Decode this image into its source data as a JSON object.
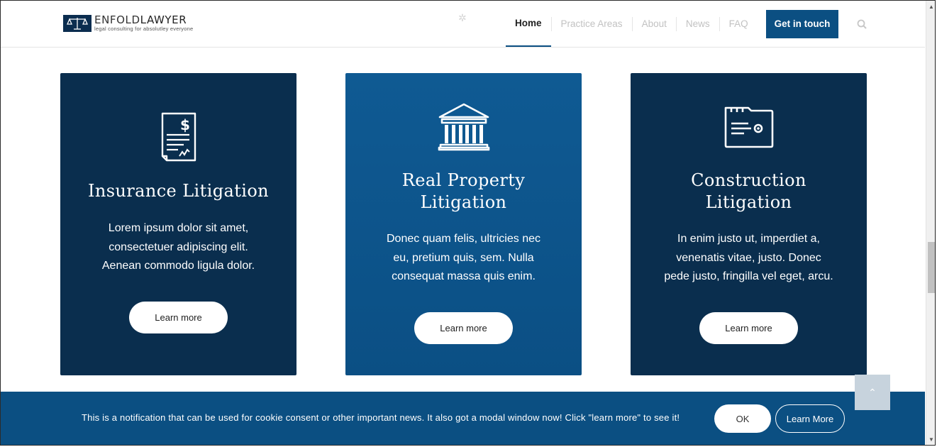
{
  "header": {
    "logo": {
      "name_part1": "ENFOLD",
      "name_part2": "LAWYER",
      "tagline": "legal consulting for absolutley everyone"
    },
    "nav": [
      {
        "label": "Home",
        "active": true
      },
      {
        "label": "Practice Areas"
      },
      {
        "label": "About"
      },
      {
        "label": "News"
      },
      {
        "label": "FAQ"
      }
    ],
    "cta_label": "Get in touch",
    "search_icon": "search-icon"
  },
  "cards": [
    {
      "icon": "invoice-dollar-icon",
      "title_line1": "Insurance Litigation",
      "title_line2": "",
      "text": [
        "Lorem ipsum dolor sit amet,",
        "consectetuer adipiscing elit.",
        "Aenean commodo ligula dolor."
      ],
      "button": "Learn more"
    },
    {
      "icon": "courthouse-icon",
      "title_line1": "Real Property",
      "title_line2": "Litigation",
      "text": [
        "Donec quam felis, ultricies nec",
        "eu, pretium quis, sem. Nulla",
        "consequat massa quis enim."
      ],
      "button": "Learn more"
    },
    {
      "icon": "folder-icon",
      "title_line1": "Construction",
      "title_line2": "Litigation",
      "text": [
        "In enim justo ut, imperdiet a,",
        "venenatis vitae, justo. Donec",
        "pede justo, fringilla vel eget, arcu."
      ],
      "button": "Learn more"
    }
  ],
  "notification": {
    "text": "This is a notification that can be used for cookie consent or other important news. It also got a modal window now! Click \"learn more\" to see it!",
    "ok_label": "OK",
    "more_label": "Learn More"
  },
  "colors": {
    "navy": "#0a2e4e",
    "brand_blue": "#0b4f82"
  }
}
